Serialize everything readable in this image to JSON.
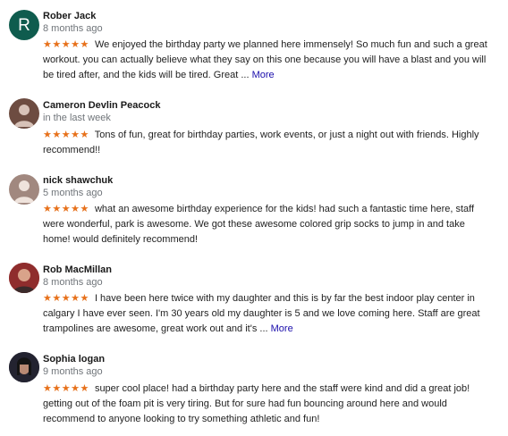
{
  "reviews": [
    {
      "name": "Rober Jack",
      "time": "8 months ago",
      "avatar": {
        "type": "letter",
        "letter": "R",
        "color": "#0f5c4e"
      },
      "rating": 5,
      "stars": "★★★★★",
      "text": "We enjoyed the birthday party we planned here immensely! So much fun and such a great workout. you can actually believe what they say on this one because you will have a blast and you will be tired after, and the kids will be tired. Great ...",
      "more": "More"
    },
    {
      "name": "Cameron Devlin Peacock",
      "time": "in the last week",
      "avatar": {
        "type": "photo",
        "icon": "person-silhouette-icon",
        "color": "#6d4c41"
      },
      "rating": 5,
      "stars": "★★★★★",
      "text": "Tons of fun, great for birthday parties, work events, or just a night out with friends. Highly recommend!!",
      "more": ""
    },
    {
      "name": "nick shawchuk",
      "time": "5 months ago",
      "avatar": {
        "type": "photo",
        "icon": "person-silhouette-icon",
        "color": "#a1887f"
      },
      "rating": 5,
      "stars": "★★★★★",
      "text": "what an awesome birthday experience for the kids! had such a fantastic time here, staff were wonderful, park is awesome. We got these awesome colored grip socks to jump in and take home! would definitely recommend!",
      "more": ""
    },
    {
      "name": "Rob MacMillan",
      "time": "8 months ago",
      "avatar": {
        "type": "photo",
        "icon": "person-photo-icon",
        "color": "#a33a3a"
      },
      "rating": 5,
      "stars": "★★★★★",
      "text": "I have been here twice with my daughter and this is by far the best indoor play center in calgary I have ever seen. I'm 30 years old my daughter is 5 and we love coming here. Staff are great trampolines are awesome, great work out and it's ...",
      "more": "More"
    },
    {
      "name": "Sophia logan",
      "time": "9 months ago",
      "avatar": {
        "type": "photo",
        "icon": "person-photo-icon",
        "color": "#2b2b3a"
      },
      "rating": 5,
      "stars": "★★★★★",
      "text": "super cool place! had a birthday party here and the staff were kind and did a great job! getting out of the foam pit is very tiring. But for sure had fun bouncing around here and would recommend to anyone looking to try something athletic and fun!",
      "more": ""
    }
  ]
}
